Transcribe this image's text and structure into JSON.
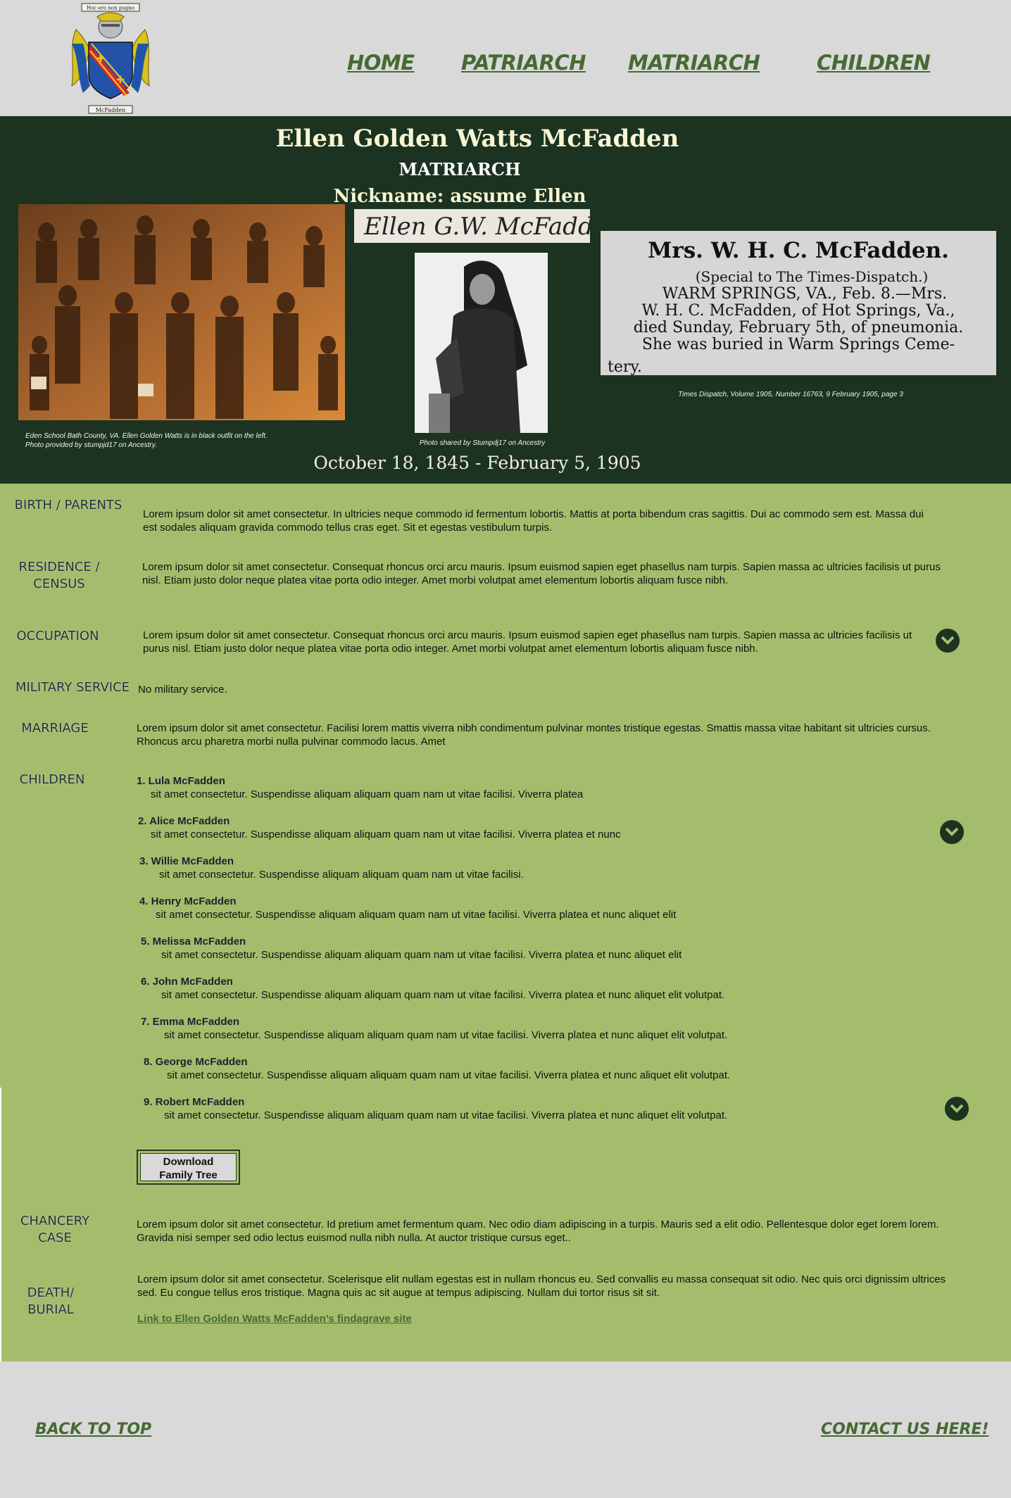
{
  "header": {
    "crest_motto": "Hoc ero non pugno",
    "crest_name": "McFadden",
    "nav": [
      "HOME",
      "PATRIARCH",
      "MATRIARCH",
      "CHILDREN"
    ]
  },
  "hero": {
    "name": "Ellen Golden Watts McFadden",
    "role": "MATRIARCH",
    "nickname": "Nickname:  assume Ellen",
    "signature_text": "Ellen G.W. McFadden",
    "clipping": {
      "headline": "Mrs. W. H. C. McFadden.",
      "lines": [
        "(Special to The Times-Dispatch.)",
        "WARM SPRINGS, VA., Feb. 8.—Mrs.",
        "W. H. C. McFadden, of Hot Springs, Va.,",
        "died Sunday, February 5th, of pneumonia.",
        "She was buried in Warm Springs Ceme-",
        "tery."
      ]
    },
    "caption_group_1": "Eden School Bath County, VA.  Ellen Golden Watts is in black outfit on the left.",
    "caption_group_2": "Photo provided by stumpjd17 on Ancestry.",
    "caption_portrait": "Photo shared by Stumpdj17 on Ancestry",
    "caption_clipping": "Times Dispatch, Volume 1905, Number 16763,  9 February 1905, page 3",
    "dates": "October 18, 1845 - February 5, 1905"
  },
  "sections": {
    "birth": {
      "label_1": "BIRTH / PARENTS",
      "text": "Lorem ipsum dolor sit amet consectetur. In ultricies neque commodo id fermentum lobortis. Mattis at porta bibendum cras sagittis. Dui ac commodo sem est. Massa dui est sodales aliquam gravida commodo tellus cras eget. Sit et egestas vestibulum turpis."
    },
    "residence": {
      "label_1": "RESIDENCE /",
      "label_2": "CENSUS",
      "text": "Lorem ipsum dolor sit amet consectetur. Consequat rhoncus orci arcu mauris. Ipsum euismod sapien eget phasellus nam turpis. Sapien massa ac ultricies facilisis ut purus nisl. Etiam justo dolor neque platea vitae porta odio integer. Amet morbi volutpat amet elementum lobortis aliquam fusce nibh."
    },
    "occupation": {
      "label_1": "OCCUPATION",
      "text": "Lorem ipsum dolor sit amet consectetur. Consequat rhoncus orci arcu mauris. Ipsum euismod sapien eget phasellus nam turpis. Sapien massa ac ultricies facilisis ut purus nisl. Etiam justo dolor neque platea vitae porta odio integer. Amet morbi volutpat amet elementum lobortis aliquam fusce nibh."
    },
    "military": {
      "label_1": "MILITARY SERVICE",
      "text": "No military service."
    },
    "marriage": {
      "label_1": "MARRIAGE",
      "text": "Lorem ipsum dolor sit amet consectetur. Facilisi lorem mattis viverra nibh condimentum pulvinar montes tristique egestas. Smattis massa vitae habitant sit ultricies cursus. Rhoncus arcu pharetra morbi nulla pulvinar commodo lacus. Amet"
    },
    "children": {
      "label_1": "CHILDREN",
      "items": [
        {
          "name": "1.  Lula McFadden",
          "text": "sit amet consectetur. Suspendisse aliquam aliquam quam nam ut vitae facilisi. Viverra platea"
        },
        {
          "name": "2.  Alice McFadden",
          "text": "sit amet consectetur. Suspendisse aliquam aliquam quam nam ut vitae facilisi. Viverra platea et nunc"
        },
        {
          "name": "3.  Willie McFadden",
          "text": "sit amet consectetur. Suspendisse aliquam aliquam quam nam ut vitae facilisi."
        },
        {
          "name": "4. Henry McFadden",
          "text": "sit amet consectetur. Suspendisse aliquam aliquam quam nam ut vitae facilisi. Viverra platea et nunc aliquet elit"
        },
        {
          "name": "5.  Melissa McFadden",
          "text": "sit amet consectetur. Suspendisse aliquam aliquam quam nam ut vitae facilisi. Viverra platea et nunc aliquet elit"
        },
        {
          "name": "6. John McFadden",
          "text": "sit amet consectetur. Suspendisse aliquam aliquam quam nam ut vitae facilisi. Viverra platea et nunc aliquet elit volutpat."
        },
        {
          "name": "7.  Emma McFadden",
          "text": "sit amet consectetur. Suspendisse aliquam aliquam quam nam ut vitae facilisi. Viverra platea et nunc aliquet elit volutpat."
        },
        {
          "name": "8.  George McFadden",
          "text": "sit amet consectetur. Suspendisse aliquam aliquam quam nam ut vitae facilisi. Viverra platea et nunc aliquet elit volutpat."
        },
        {
          "name": "9.  Robert  McFadden",
          "text": "sit amet consectetur. Suspendisse aliquam aliquam quam nam ut vitae facilisi. Viverra platea et nunc aliquet elit volutpat."
        }
      ],
      "download_1": "Download",
      "download_2": "Family Tree"
    },
    "chancery": {
      "label_1": "CHANCERY",
      "label_2": "CASE",
      "text": "Lorem ipsum dolor sit amet consectetur. Id pretium amet fermentum quam. Nec odio diam adipiscing in a turpis. Mauris sed a elit odio. Pellentesque dolor eget lorem lorem. Gravida nisi semper sed odio lectus euismod nulla nibh nulla. At auctor tristique cursus eget.."
    },
    "death": {
      "label_1": "DEATH/",
      "label_2": "BURIAL",
      "text": "Lorem ipsum dolor sit amet consectetur. Scelerisque elit nullam egestas est in nullam rhoncus eu. Sed convallis eu massa consequat sit odio. Nec quis orci dignissim ultrices sed. Eu congue tellus eros tristique. Magna quis ac sit augue at tempus adipiscing. Nullam dui tortor risus sit sit.",
      "link": "Link to Ellen Golden Watts McFadden’s findagrave site"
    }
  },
  "footer": {
    "back_to_top": "BACK TO TOP",
    "contact": "CONTACT US HERE!"
  },
  "colors": {
    "hero_bg": "#1b3320",
    "main_bg": "#a4bd6c",
    "page_bg": "#d9d9d9",
    "link": "#466a33"
  }
}
